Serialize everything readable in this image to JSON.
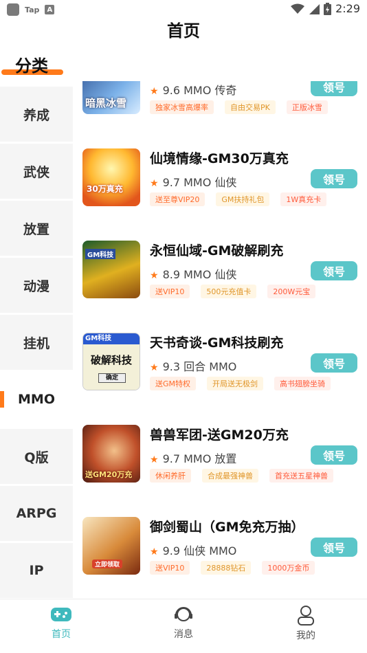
{
  "status_bar": {
    "app_label": "Tap",
    "time": "2:29"
  },
  "header": {
    "title": "首页"
  },
  "sidebar": {
    "heading": "分类",
    "items": [
      {
        "label": "养成"
      },
      {
        "label": "武侠"
      },
      {
        "label": "放置"
      },
      {
        "label": "动漫"
      },
      {
        "label": "挂机"
      },
      {
        "label": "MMO",
        "active": true
      },
      {
        "label": "Q版"
      },
      {
        "label": "ARPG"
      },
      {
        "label": "IP"
      }
    ]
  },
  "games": [
    {
      "title": "",
      "rating": "9.6",
      "genres": "MMO 传奇",
      "tags": [
        "独家冰雪高爆率",
        "自由交易PK",
        "正版冰雪"
      ],
      "button": "领号",
      "thumb_text": "暗黑冰雪"
    },
    {
      "title": "仙境情缘-GM30万真充",
      "rating": "9.7",
      "genres": "MMO 仙侠",
      "tags": [
        "送至尊VIP20",
        "GM扶持礼包",
        "1W真充卡"
      ],
      "button": "领号",
      "thumb_text": "30万真充"
    },
    {
      "title": "永恒仙域-GM破解刷充",
      "rating": "8.9",
      "genres": "MMO 仙侠",
      "tags": [
        "送VIP10",
        "500元充值卡",
        "200W元宝"
      ],
      "button": "领号",
      "thumb_text": "GM科技"
    },
    {
      "title": "天书奇谈-GM科技刷充",
      "rating": "9.3",
      "genres": "回合 MMO",
      "tags": [
        "送GM特权",
        "开局送无极剑",
        "高书翅膀坐骑"
      ],
      "button": "领号",
      "thumb_text": "GM科技",
      "thumb_sub": "破解科技",
      "thumb_btn": "确定"
    },
    {
      "title": "兽兽军团-送GM20万充",
      "rating": "9.7",
      "genres": "MMO 放置",
      "tags": [
        "休闲养肝",
        "合成最强神兽",
        "首充送五星神兽"
      ],
      "button": "领号",
      "thumb_text": "送GM20万充"
    },
    {
      "title": "御剑蜀山（GM免充万抽）",
      "rating": "9.9",
      "genres": "仙侠 MMO",
      "tags": [
        "送VIP10",
        "28888钻石",
        "1000万金币"
      ],
      "button": "领号",
      "thumb_text": "立即领取"
    }
  ],
  "bottom_nav": {
    "items": [
      {
        "label": "首页",
        "active": true
      },
      {
        "label": "消息"
      },
      {
        "label": "我的"
      }
    ]
  },
  "colors": {
    "accent": "#ff7a1a",
    "button": "#5bc6c9",
    "nav_active": "#3fb9bd"
  }
}
